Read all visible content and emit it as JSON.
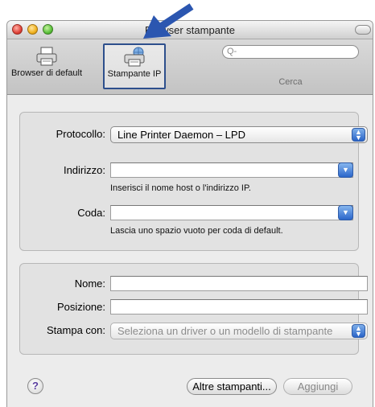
{
  "window": {
    "title": "Browser stampante"
  },
  "toolbar": {
    "default_browser_label": "Browser di default",
    "ip_printer_label": "Stampante IP",
    "search_placeholder": "Q-",
    "search_label": "Cerca"
  },
  "form_top": {
    "protocol_label": "Protocollo:",
    "protocol_value": "Line Printer Daemon – LPD",
    "address_label": "Indirizzo:",
    "address_value": "",
    "address_hint": "Inserisci il nome host o l'indirizzo IP.",
    "queue_label": "Coda:",
    "queue_value": "",
    "queue_hint": "Lascia uno spazio vuoto per coda di default."
  },
  "form_bottom": {
    "name_label": "Nome:",
    "name_value": "",
    "location_label": "Posizione:",
    "location_value": "",
    "print_with_label": "Stampa con:",
    "print_with_value": "Seleziona un driver o un modello di stampante"
  },
  "buttons": {
    "help": "?",
    "more_printers": "Altre stampanti...",
    "add": "Aggiungi"
  },
  "colors": {
    "callout_arrow": "#2b56b0",
    "selection_outline": "#2d4f8c",
    "aqua_blue": "#2a64c8"
  }
}
